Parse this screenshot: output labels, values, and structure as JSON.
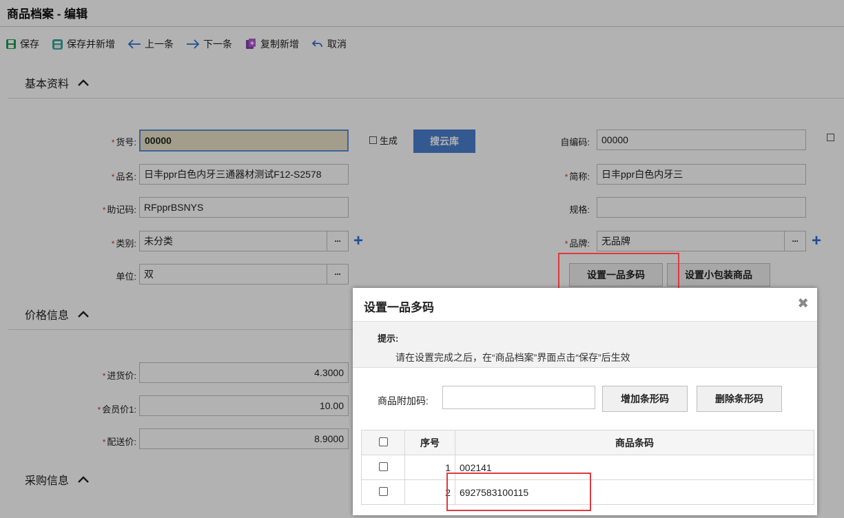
{
  "page": {
    "title": "商品档案 - 编辑"
  },
  "toolbar": {
    "save": "保存",
    "save_new": "保存并新增",
    "prev": "上一条",
    "next": "下一条",
    "copy_new": "复制新增",
    "cancel": "取消"
  },
  "sections": {
    "basic": "基本资料",
    "price": "价格信息",
    "purchase": "采购信息"
  },
  "form": {
    "item_no_label": "货号:",
    "item_no_value": "00000",
    "generate_label": "生成",
    "search_cloud_label": "搜云库",
    "self_code_label": "自编码:",
    "self_code_value": "00000",
    "name_label": "品名:",
    "name_value": "日丰ppr白色内牙三通器材测试F12-S2578",
    "short_name_label": "简称:",
    "short_name_value": "日丰ppr白色内牙三",
    "mnemonic_label": "助记码:",
    "mnemonic_value": "RFpprBSNYS",
    "spec_label": "规格:",
    "spec_value": "",
    "category_label": "类别:",
    "category_value": "未分类",
    "brand_label": "品牌:",
    "brand_value": "无品牌",
    "unit_label": "单位:",
    "unit_value": "双",
    "multi_code_button": "设置一品多码",
    "small_pack_button": "设置小包装商品",
    "cost_label": "进货价:",
    "cost_value": "4.3000",
    "member_price_label": "会员价1:",
    "member_price_value": "10.00",
    "delivery_price_label": "配送价:",
    "delivery_price_value": "8.9000"
  },
  "dialog": {
    "title": "设置一品多码",
    "tip_title": "提示:",
    "tip_text": "请在设置完成之后，在“商品档案”界面点击“保存”后生效",
    "extra_code_label": "商品附加码:",
    "extra_code_value": "",
    "add_button": "增加条形码",
    "delete_button": "删除条形码",
    "table": {
      "col_seq": "序号",
      "col_barcode": "商品条码",
      "rows": [
        {
          "seq": "1",
          "barcode": "002141"
        },
        {
          "seq": "2",
          "barcode": "6927583100115"
        }
      ]
    }
  },
  "colors": {
    "accent_blue": "#4b7fcf",
    "required_red": "#d9342b",
    "highlight_box": "#e0393e"
  }
}
